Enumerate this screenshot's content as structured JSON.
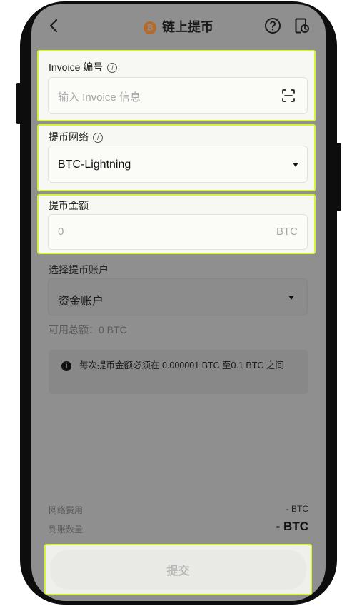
{
  "header": {
    "title": "链上提币",
    "coin_symbol": "₿",
    "back_icon": "chevron-left-icon",
    "help_icon": "help-circle-icon",
    "history_icon": "history-icon"
  },
  "invoice": {
    "label": "Invoice 编号",
    "placeholder": "输入 Invoice 信息",
    "scan_icon": "scan-icon"
  },
  "network": {
    "label": "提币网络",
    "selected": "BTC-Lightning"
  },
  "amount": {
    "label": "提币金额",
    "placeholder": "0",
    "unit": "BTC"
  },
  "account": {
    "label": "选择提币账户",
    "selected": "资金账户",
    "available_label": "可用总额：",
    "available_value": "0 BTC"
  },
  "notice": {
    "text": "每次提币金额必须在 0.000001 BTC 至0.1 BTC 之间"
  },
  "summary": {
    "fee_label": "网络费用",
    "fee_value": "- BTC",
    "receive_label": "到账数量",
    "receive_value": "- BTC"
  },
  "submit": {
    "label": "提交"
  },
  "colors": {
    "highlight": "#d8f23a",
    "overlay": "#8f8f8f",
    "coin": "#b56a27"
  }
}
